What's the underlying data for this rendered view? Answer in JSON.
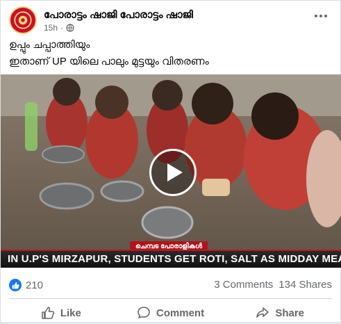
{
  "post": {
    "page_name": "പോരാട്ടം ഷാജി പോരാട്ടം ഷാജി",
    "time": "15h",
    "separator": "·",
    "caption_lines": [
      "ഉപ്പും ചപ്പാത്തിയും",
      "ഇതാണ് UP യിലെ പാലും മുട്ടയും വിതരണം"
    ]
  },
  "video": {
    "channel_tag": "ചെമ്പട പോരാളികൾ",
    "ticker_text": "IN U.P'S MIRZAPUR, STUDENTS GET ROTI, SALT AS MIDDAY MEAL",
    "play_icon": "play-icon"
  },
  "stats": {
    "reaction_icon": "like-icon",
    "reaction_count": "210",
    "comments": "3 Comments",
    "shares": "134 Shares"
  },
  "actions": {
    "like": "Like",
    "comment": "Comment",
    "share": "Share"
  },
  "colors": {
    "accent": "#1877f2",
    "ticker_red": "#c0141f",
    "secondary_text": "#65676b"
  }
}
